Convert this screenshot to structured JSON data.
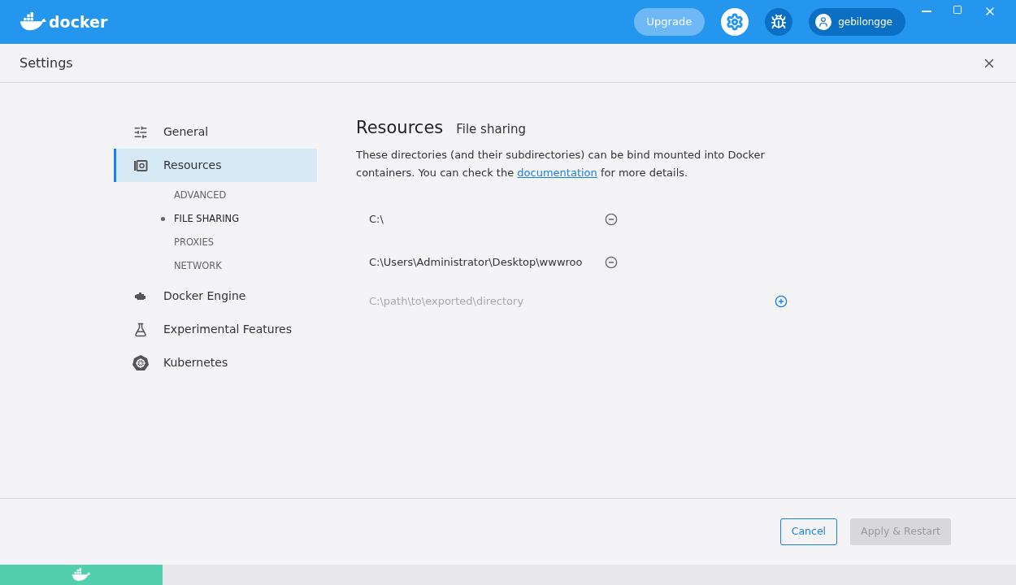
{
  "header": {
    "logo_text": "docker",
    "upgrade": "Upgrade",
    "user": "gebilongge"
  },
  "settings": {
    "title": "Settings"
  },
  "sidebar": {
    "items": [
      {
        "label": "General",
        "selected": false
      },
      {
        "label": "Resources",
        "selected": true,
        "children": [
          {
            "label": "ADVANCED",
            "selected": false
          },
          {
            "label": "FILE SHARING",
            "selected": true
          },
          {
            "label": "PROXIES",
            "selected": false
          },
          {
            "label": "NETWORK",
            "selected": false
          }
        ]
      },
      {
        "label": "Docker Engine",
        "selected": false
      },
      {
        "label": "Experimental Features",
        "selected": false
      },
      {
        "label": "Kubernetes",
        "selected": false
      }
    ]
  },
  "content": {
    "title": "Resources",
    "subtitle": "File sharing",
    "description_before": "These directories (and their subdirectories) can be bind mounted into Docker containers. You can check the ",
    "description_link": "documentation",
    "description_after": " for more details.",
    "directories": [
      "C:\\",
      "C:\\Users\\Administrator\\Desktop\\wwwroo"
    ],
    "new_directory": {
      "placeholder": "C:\\path\\to\\exported\\directory"
    }
  },
  "footer": {
    "buttons": [
      {
        "label": "Cancel",
        "disabled": false
      },
      {
        "label": "Apply & Restart",
        "disabled": true
      }
    ]
  }
}
